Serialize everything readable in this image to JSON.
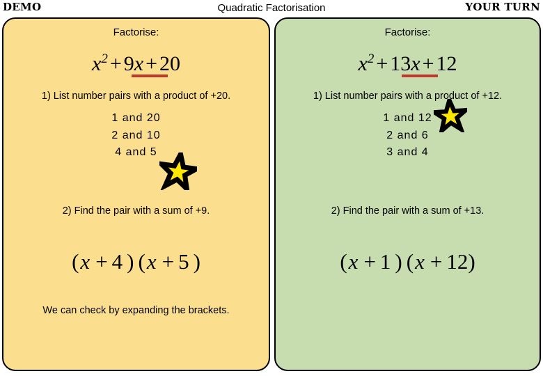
{
  "header": {
    "left_badge": "DEMO",
    "title": "Quadratic Factorisation",
    "right_badge": "YOUR TURN"
  },
  "colors": {
    "left_panel_bg": "#FBDF8F",
    "right_panel_bg": "#C7DCAF",
    "underline": "#C0392B",
    "star_fill": "#FFE800",
    "star_stroke": "#000000",
    "border": "#000000"
  },
  "panels": [
    {
      "id": "demo",
      "prompt": "Factorise:",
      "equation": {
        "lead_var": "x",
        "exponent": "2",
        "term_two_op": "+",
        "term_two_coeff": "9",
        "term_two_var": "x",
        "term_three_op": "+",
        "constant": "20",
        "plain": "x² + 9x + 20"
      },
      "step_one": "1) List number pairs with a product of +20.",
      "pairs": [
        {
          "text": "1 and 20",
          "starred": false
        },
        {
          "text": "2 and 10",
          "starred": false
        },
        {
          "text": "4 and 5",
          "starred": true
        }
      ],
      "step_two": "2) Find the pair with a sum of +9.",
      "answer": {
        "first_var": "x",
        "first_op": "+",
        "first_num": "4",
        "second_var": "x",
        "second_op": "+",
        "second_num": "5",
        "plain": "( x + 4 ) ( x + 5 )"
      },
      "footnote": "We can check by expanding the brackets."
    },
    {
      "id": "your-turn",
      "prompt": "Factorise:",
      "equation": {
        "lead_var": "x",
        "exponent": "2",
        "term_two_op": "+",
        "term_two_coeff": "13",
        "term_two_var": "x",
        "term_three_op": "+",
        "constant": "12",
        "plain": "x² + 13x + 12"
      },
      "step_one": "1) List number pairs with a product of +12.",
      "pairs": [
        {
          "text": "1 and 12",
          "starred": true
        },
        {
          "text": "2 and 6",
          "starred": false
        },
        {
          "text": "3 and 4",
          "starred": false
        }
      ],
      "step_two": "2) Find the pair with a sum of +13.",
      "answer": {
        "first_var": "x",
        "first_op": "+",
        "first_num": "1",
        "second_var": "x",
        "second_op": "+",
        "second_num": "12",
        "plain": "( x + 1 ) ( x + 12)"
      },
      "footnote": ""
    }
  ],
  "icons": {
    "star": "star-icon"
  }
}
